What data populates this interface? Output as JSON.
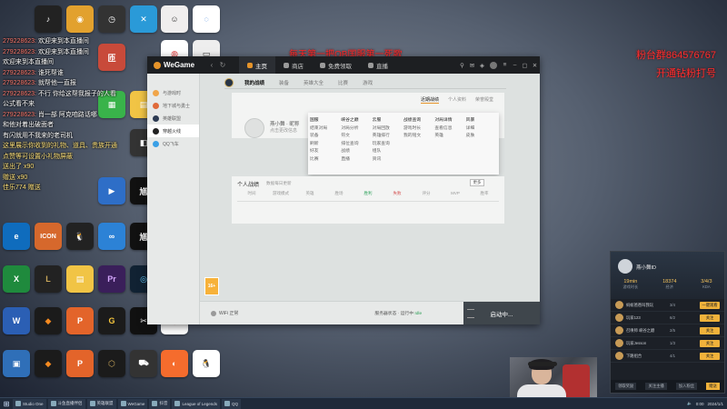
{
  "banner_top": "每天第一把OB国服第一死歌",
  "banner_right": [
    "粉台群864576767",
    "开通钻粉打号"
  ],
  "chat": [
    {
      "name": "279228623:",
      "msg": "欢迎来到本直播间"
    },
    {
      "name": "279228623:",
      "msg": "欢迎来到本直播间"
    },
    {
      "name": "",
      "msg": "欢迎来到本直播间"
    },
    {
      "name": "279228623:",
      "msg": "谁死帮谁"
    },
    {
      "name": "279228623:",
      "msg": "就帮他一直报"
    },
    {
      "name": "279228623:",
      "msg": "不行 你给这帮我报子的人看"
    },
    {
      "name": "",
      "msg": "公式看不来"
    },
    {
      "name": "279228623:",
      "msg": "肖一部 阿克咱路话哪"
    },
    {
      "name": "",
      "msg": "和他对着出破面者"
    },
    {
      "name": "",
      "msg": "有闪就用不我来的老司机"
    },
    {
      "name": "",
      "msg": "这里展示你收到的礼物、道具、贵族开通"
    },
    {
      "name": "",
      "msg": "点赞等可设置小礼物屏蔽"
    },
    {
      "name": "",
      "msg": "送出了 x90"
    },
    {
      "name": "",
      "msg": "赠送 x90"
    },
    {
      "name": "",
      "msg": "佳乐774 赠送"
    }
  ],
  "desktop_icons": [
    {
      "label": "匝",
      "color": "#c84a3a"
    },
    {
      "label": "ICON",
      "color": "#d6682c"
    },
    {
      "label": "Pr",
      "color": "#3a1f5a"
    },
    {
      "label": "X",
      "color": "#1f8a3d"
    },
    {
      "label": "W",
      "color": "#2b5fb4"
    }
  ],
  "wegame": {
    "logo": "WeGame",
    "top_tabs": [
      "主页",
      "商店",
      "免费领取",
      "直播"
    ],
    "rail_items": [
      "与游戏时",
      "地下城与勇士",
      "英雄联盟",
      "穿越火线",
      "QQ飞车"
    ],
    "rail_badge": "16+",
    "subnav": [
      "我的战绩",
      "装备",
      "英雄大全",
      "比赛",
      "游戏"
    ],
    "profile_tabs": [
      "近期战绩",
      "个人资料",
      "荣誉殿堂"
    ],
    "profile_name": "燕小舞 · 昵称",
    "profile_meta": "点击更改信息",
    "menu": [
      [
        "国服",
        "峡谷之巅",
        "云服",
        "战绩查询",
        "对局详情",
        "风暴"
      ],
      [
        "结束对局",
        "对局分析",
        "对局回放",
        "游戏时长",
        "查看信息",
        "详细"
      ],
      [
        "装备",
        "符文",
        "英雄排行",
        "我的铭文",
        "英雄",
        "皮肤"
      ],
      [
        "刷新",
        "排位查询",
        "玩家查询",
        "",
        "",
        ""
      ],
      [
        "好友",
        "战绩",
        "组队",
        "",
        "",
        ""
      ],
      [
        "比赛",
        "直播",
        "资讯",
        "",
        "",
        ""
      ]
    ],
    "stats_title": "个人战绩",
    "stats_hint": "数据每日更新",
    "stats_btn": "更多",
    "stats_headers": [
      "时间",
      "游戏模式",
      "英雄",
      "胜场",
      "胜利",
      "失败",
      "评分",
      "MVP",
      "胜率"
    ],
    "bottom_left": "WiFi 正常",
    "bottom_mid_prefix": "服务器状态 · 运行中",
    "bottom_mid_status": "Idle",
    "launch_label": "启动中..."
  },
  "rpanel": {
    "name": "燕小舞ID",
    "stats": [
      {
        "v": "19min",
        "k": "游戏时长"
      },
      {
        "v": "18374",
        "k": "经济"
      },
      {
        "v": "3/4/3",
        "k": "KDA"
      }
    ],
    "rows": [
      {
        "txt": "蚂蚁爸爸叫我玩",
        "kda": "3/4",
        "btn": "一键观看"
      },
      {
        "txt": "玩家123",
        "kda": "6/2",
        "btn": "关注"
      },
      {
        "txt": "召唤师 峡谷之巅",
        "kda": "2/5",
        "btn": "关注"
      },
      {
        "txt": "玩家Jesson",
        "kda": "1/3",
        "btn": "关注"
      },
      {
        "txt": "下路组合",
        "kda": "4/1",
        "btn": "关注"
      }
    ],
    "footer": [
      "领取奖励",
      "关注主播",
      "加入粉丝",
      "赠送"
    ]
  },
  "taskbar": {
    "items": [
      "Studio One",
      "斗鱼直播伴侣",
      "英雄联盟",
      "WeGame",
      "抖音",
      "League of Legends",
      "QQ"
    ],
    "tray_time": "0:00",
    "tray_date": "2024/1/1"
  }
}
